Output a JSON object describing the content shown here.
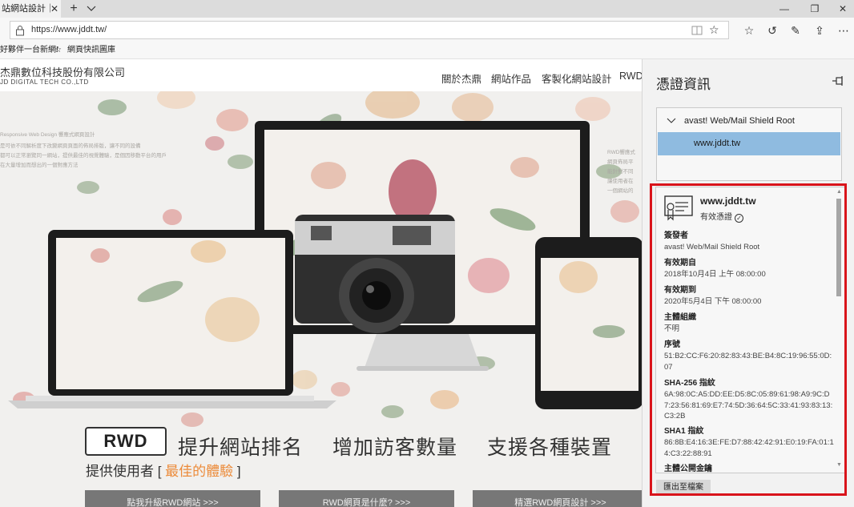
{
  "browser": {
    "tab_title": "站網站設計｜",
    "url": "https://www.jddt.tw/",
    "favorites": [
      "好夥伴一台新網!",
      "網頁快訊圖庫"
    ]
  },
  "site": {
    "company_name": "杰鼎數位科技股份有限公司",
    "company_sub": "JD DIGITAL TECH CO.,LTD",
    "nav": [
      "關於杰鼎",
      "網站作品",
      "客製化網站設計",
      "RWD"
    ],
    "hero_left_text": [
      "Responsive Web Design 響應式網頁設計",
      "是可依不同解析度下改變網頁頁面的佈局排版，讓不同的設備",
      "都可以正常瀏覽同一網站，提供最佳的視覺體驗，是個因移動平台的用戶",
      "在大量增加而想出的一個對應方法"
    ],
    "hero_right_text": [
      "RWD響應式",
      "網頁佈局平",
      "能針對不同",
      "讓使用者在",
      "一個網站的"
    ],
    "rwd_label": "RWD",
    "slogans": [
      "提升網站排名",
      "增加訪客數量",
      "支援各種裝置"
    ],
    "sub_prefix": "提供使用者 [ ",
    "sub_accent": "最佳的體驗",
    "sub_suffix": " ]",
    "buttons": [
      "點我升級RWD網站 >>>",
      "RWD網頁是什麼? >>>",
      "精選RWD網頁設計 >>>"
    ]
  },
  "panel": {
    "title": "憑證資訊",
    "chain_root": "avast! Web/Mail Shield Root",
    "chain_leaf": "www.jddt.tw",
    "cert_name": "www.jddt.tw",
    "cert_status": "有效憑證",
    "fields": [
      {
        "label": "簽發者",
        "value": "avast! Web/Mail Shield Root"
      },
      {
        "label": "有效期自",
        "value": "2018年10月4日 上午 08:00:00"
      },
      {
        "label": "有效期到",
        "value": "2020年5月4日 下午 08:00:00"
      },
      {
        "label": "主體組織",
        "value": "不明"
      },
      {
        "label": "序號",
        "value": "51:B2:CC:F6:20:82:83:43:BE:B4:8C:19:96:55:0D:07"
      },
      {
        "label": "SHA-256 指紋",
        "value": "6A:98:0C:A5:DD:EE:D5:8C:05:89:61:98:A9:9C:D7:23:56:81:69:E7:74:5D:36:64:5C:33:41:93:83:13:C3:2B"
      },
      {
        "label": "SHA1 指紋",
        "value": "86:8B:E4:16:3E:FE:D7:88:42:42:91:E0:19:FA:01:14:C3:22:88:91"
      },
      {
        "label": "主體公開金鑰",
        "value": ""
      }
    ],
    "export_label": "匯出至檔案"
  }
}
